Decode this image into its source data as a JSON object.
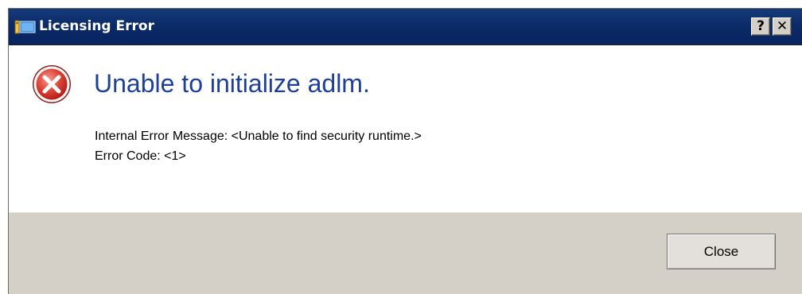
{
  "window": {
    "title": "Licensing Error",
    "help_button": "?",
    "close_glyph": "✕",
    "title_icon": "licensing-app-icon"
  },
  "content": {
    "error_icon": "error-x-icon",
    "heading": "Unable to initialize adlm.",
    "message_line_1": "Internal Error Message: <Unable to find security runtime.>",
    "message_line_2": "Error Code: <1>"
  },
  "footer": {
    "close_button_label": "Close"
  },
  "colors": {
    "titlebar": "#0a2a66",
    "heading": "#1e3f9a",
    "footer": "#d4d0c8",
    "error_red": "#d9322b"
  }
}
